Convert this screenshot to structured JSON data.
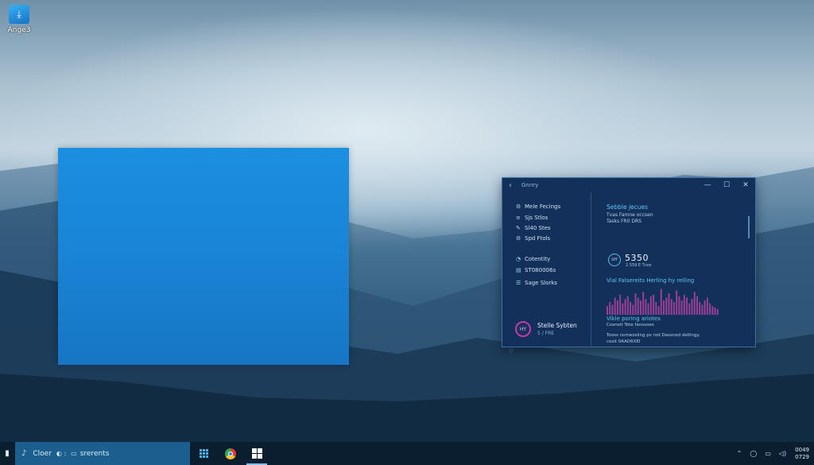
{
  "desktop": {
    "icon_label": "Ange3",
    "icon_glyph": "download-icon"
  },
  "window": {
    "title": "Gnnry",
    "controls": [
      "—",
      "☐",
      "✕"
    ],
    "sidebar": {
      "items": [
        {
          "label": "Mele Fecings",
          "icon": "settings-icon"
        },
        {
          "label": "Sjs Stlos",
          "icon": "sliders-icon"
        },
        {
          "label": "Sl40 Stes",
          "icon": "edit-icon"
        },
        {
          "label": "Spd Ftols",
          "icon": "gear-icon"
        },
        {
          "label": "Cotentity",
          "icon": "user-icon"
        },
        {
          "label": "ST080006s",
          "icon": "storage-icon"
        },
        {
          "label": "Sage Slorks",
          "icon": "stack-icon"
        }
      ],
      "profile": {
        "initials": "HY",
        "name": "Stelle Sybten",
        "sub": "5 / FRE"
      }
    },
    "content": {
      "heading": "Sebble jecues",
      "sub1": "Tvas Famne occsen",
      "sub2": "Tasks FR0 DRS",
      "stat_badge": "UY",
      "stat_value": "5350",
      "stat_sub": "2 559 E Tnos",
      "chart_title": "Vial Falsereits Herling hy relling",
      "footer_heading": "Vikle poring ariotes",
      "footer_sub": "Cosnoit Tote fanssoes",
      "footer_desc1": "Tooss nomeosling pv rod Dasonsd dellingy.",
      "footer_desc2": "cosit 0AAD6XEI"
    }
  },
  "chart_data": {
    "type": "bar",
    "series": [
      {
        "color": "#9a3f96",
        "values": [
          6,
          9,
          7,
          12,
          10,
          14,
          8,
          11,
          13,
          9,
          7,
          15,
          12,
          10,
          16,
          11,
          8,
          13,
          14,
          9,
          6,
          18,
          10,
          12,
          15,
          11,
          9,
          17,
          13,
          10,
          14,
          12,
          8,
          11,
          16,
          13,
          9,
          7,
          10,
          12,
          8,
          6,
          5,
          4
        ]
      }
    ],
    "ylim": [
      0,
      20
    ]
  },
  "taskbar": {
    "search_text": "Cloer",
    "search_extra": "srerents",
    "apps": [
      "grid-app-icon",
      "chrome-icon",
      "windows-icon"
    ],
    "tray_icons": [
      "chevron-up-icon",
      "network-icon",
      "battery-icon",
      "volume-icon"
    ],
    "clock_time": "0049",
    "clock_date": "0729"
  }
}
